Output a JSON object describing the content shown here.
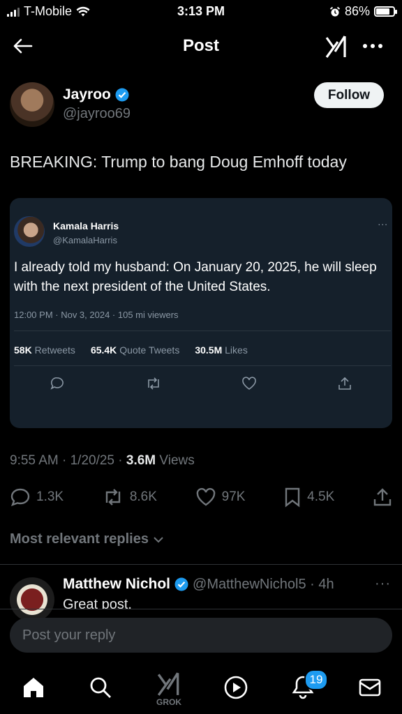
{
  "status_bar": {
    "carrier": "T-Mobile",
    "time": "3:13 PM",
    "battery_percent": "86%",
    "battery_level": 0.86
  },
  "header": {
    "title": "Post",
    "back_icon": "arrow-left-icon",
    "logo_icon": "xai-grok-icon",
    "more_icon": "more-horizontal-icon"
  },
  "post": {
    "author": {
      "name": "Jayroo",
      "handle": "@jayroo69",
      "verified": true
    },
    "follow_label": "Follow",
    "text": "BREAKING:  Trump to bang Doug Emhoff today",
    "embedded": {
      "name": "Kamala Harris",
      "handle": "@KamalaHarris",
      "more": "...",
      "text": "I already told my husband: On January 20, 2025, he will sleep with the next president of the United States.",
      "meta": "12:00 PM · Nov 3, 2024 · 105 mi viewers",
      "retweets_value": "58K",
      "retweets_label": "Retweets",
      "quotes_value": "65.4K",
      "quotes_label": "Quote Tweets",
      "likes_value": "30.5M",
      "likes_label": "Likes"
    },
    "meta_time": "9:55 AM · 1/20/25 · ",
    "views_value": "3.6M",
    "views_label": "Views",
    "replies_count": "1.3K",
    "reposts_count": "8.6K",
    "likes_count": "97K",
    "bookmarks_count": "4.5K"
  },
  "replies_sort": {
    "label": "Most relevant replies"
  },
  "reply": {
    "name": "Matthew Nichol",
    "handle": "@MatthewNichol5 · 4h",
    "text": "Great post.",
    "more": "···"
  },
  "reply_box": {
    "placeholder": "Post your reply"
  },
  "tabbar": {
    "grok_label": "GROK",
    "notifications_badge": "19"
  },
  "colors": {
    "accent": "#1d9bf0",
    "embed_bg": "#15202b",
    "muted": "#71767b"
  }
}
